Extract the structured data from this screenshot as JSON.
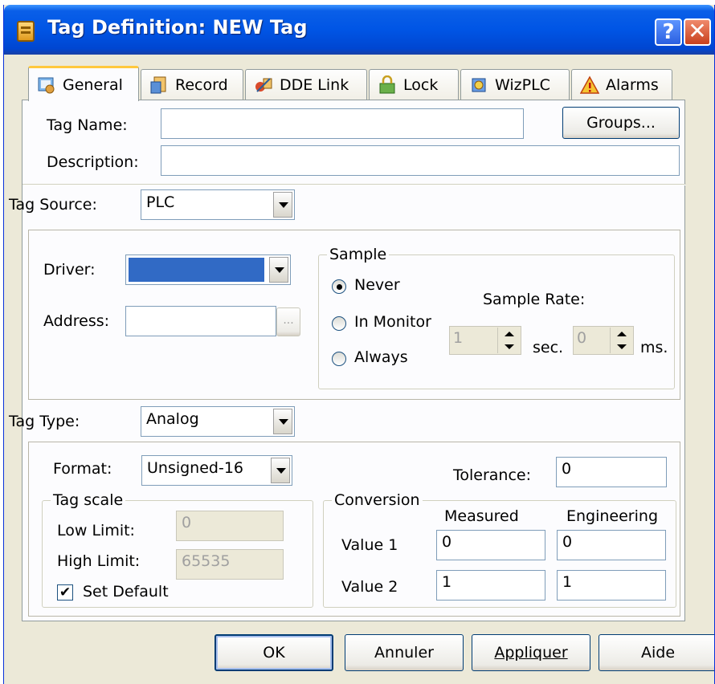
{
  "window": {
    "title": "Tag Definition: NEW Tag",
    "help_glyph": "?",
    "close_glyph": "✕"
  },
  "tabs": [
    {
      "label": "General",
      "icon": "general-icon",
      "active": true
    },
    {
      "label": "Record",
      "icon": "record-icon",
      "active": false
    },
    {
      "label": "DDE Link",
      "icon": "dde-link-icon",
      "active": false
    },
    {
      "label": "Lock",
      "icon": "lock-icon",
      "active": false
    },
    {
      "label": "WizPLC",
      "icon": "wizplc-icon",
      "active": false
    },
    {
      "label": "Alarms",
      "icon": "alarms-icon",
      "active": false
    }
  ],
  "general": {
    "tag_name_label": "Tag Name:",
    "tag_name_value": "",
    "groups_button": "Groups...",
    "description_label": "Description:",
    "description_value": "",
    "tag_source_label": "Tag Source:",
    "tag_source_value": "PLC",
    "driver_label": "Driver:",
    "driver_value": "",
    "address_label": "Address:",
    "address_value": "",
    "browse_button": "...",
    "sample": {
      "title": "Sample",
      "options": [
        "Never",
        "In Monitor",
        "Always"
      ],
      "selected": "Never",
      "rate_label": "Sample Rate:",
      "sec_value": "1",
      "sec_label": "sec.",
      "ms_value": "0",
      "ms_label": "ms."
    },
    "tag_type_label": "Tag Type:",
    "tag_type_value": "Analog",
    "format_label": "Format:",
    "format_value": "Unsigned-16",
    "tolerance_label": "Tolerance:",
    "tolerance_value": "0",
    "tag_scale": {
      "title": "Tag scale",
      "low_label": "Low Limit:",
      "low_value": "0",
      "high_label": "High Limit:",
      "high_value": "65535",
      "set_default_label": "Set Default",
      "set_default_checked": true
    },
    "conversion": {
      "title": "Conversion",
      "measured_header": "Measured",
      "engineering_header": "Engineering",
      "value1_label": "Value 1",
      "value1_measured": "0",
      "value1_engineering": "0",
      "value2_label": "Value 2",
      "value2_measured": "1",
      "value2_engineering": "1"
    }
  },
  "buttons": {
    "ok": "OK",
    "cancel": "Annuler",
    "apply": "Appliquer",
    "help": "Aide"
  },
  "colors": {
    "titlebar": "#0055e5",
    "selection": "#316ac5",
    "dialog_bg": "#ece9d8"
  }
}
